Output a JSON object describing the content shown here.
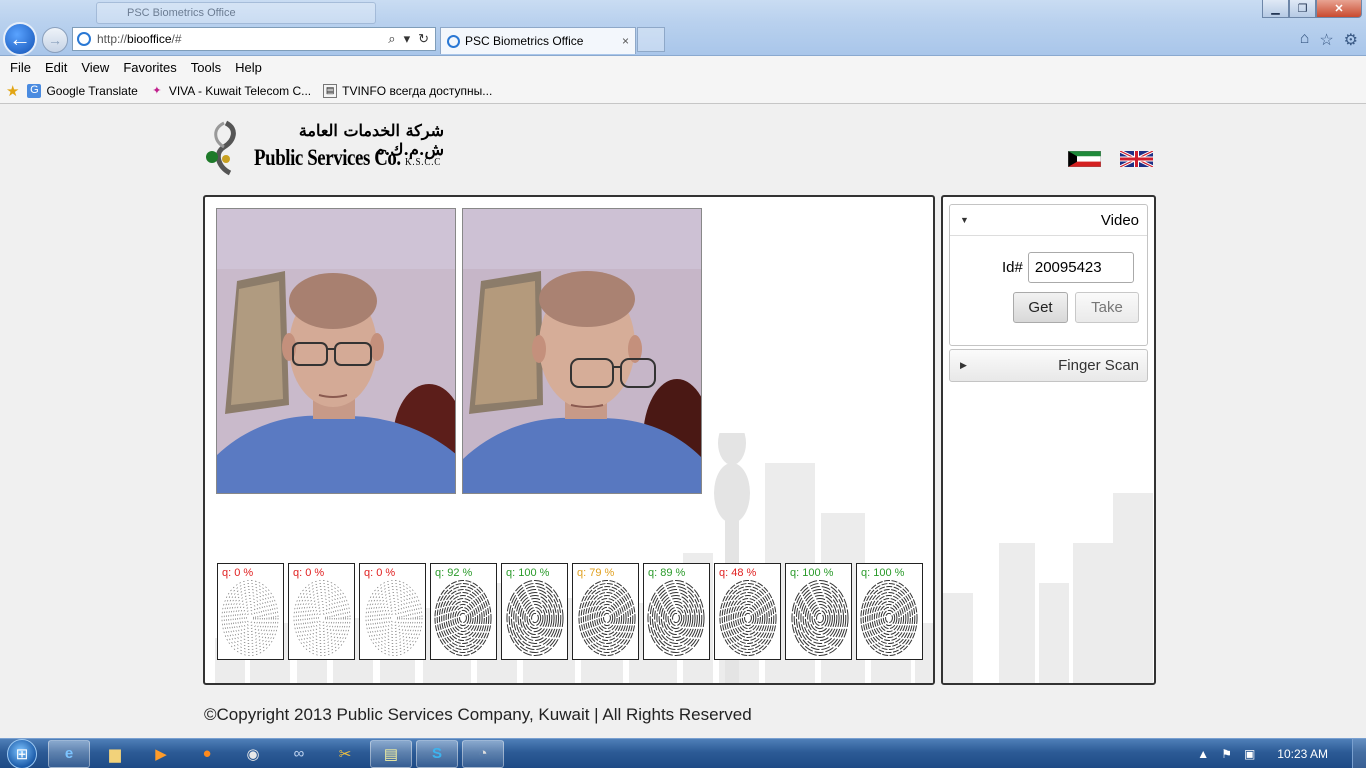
{
  "browser": {
    "background_tab_title": "PSC Biometrics Office",
    "address": {
      "prefix": "http://",
      "host": "biooffice",
      "path": "/#"
    },
    "active_tab_title": "PSC Biometrics Office",
    "tab_close_glyph": "×",
    "window_controls": [
      "minimize",
      "restore",
      "close"
    ]
  },
  "menu": [
    "File",
    "Edit",
    "View",
    "Favorites",
    "Tools",
    "Help"
  ],
  "favorites": [
    {
      "label": "Google Translate",
      "icon": "google-translate-icon"
    },
    {
      "label": "VIVA - Kuwait Telecom C...",
      "icon": "viva-icon"
    },
    {
      "label": "TVINFO  всегда доступны...",
      "icon": "tvinfo-icon"
    }
  ],
  "header": {
    "logo_arabic": "شركة الخدمات العامة ش.م.ك.م",
    "logo_english": "Public Services Co.",
    "logo_suffix": "K.S.C.C",
    "languages": [
      "Kuwait flag",
      "UK flag"
    ]
  },
  "video_panel": {
    "title": "Video",
    "id_label": "Id#",
    "id_value": "20095423",
    "get_label": "Get",
    "take_label": "Take"
  },
  "finger_panel": {
    "title": "Finger Scan"
  },
  "fingerprints": [
    {
      "quality": "q: 0 %",
      "color": "#e02020"
    },
    {
      "quality": "q: 0 %",
      "color": "#e02020"
    },
    {
      "quality": "q: 0 %",
      "color": "#e02020"
    },
    {
      "quality": "q: 92 %",
      "color": "#2a9a2a"
    },
    {
      "quality": "q: 100 %",
      "color": "#2a9a2a"
    },
    {
      "quality": "q: 79 %",
      "color": "#e0a020"
    },
    {
      "quality": "q: 89 %",
      "color": "#2a9a2a"
    },
    {
      "quality": "q: 48 %",
      "color": "#e02020"
    },
    {
      "quality": "q: 100 %",
      "color": "#2a9a2a"
    },
    {
      "quality": "q: 100 %",
      "color": "#2a9a2a"
    }
  ],
  "footer": {
    "copyright": "©Copyright 2013 Public Services Company, Kuwait | All Rights Reserved"
  },
  "taskbar": {
    "clock": "10:23 AM",
    "items": [
      "internet-explorer",
      "file-explorer",
      "media-player",
      "firefox",
      "chrome",
      "app-infinity",
      "app-tools",
      "notepad",
      "skype",
      "app-gauge"
    ]
  }
}
